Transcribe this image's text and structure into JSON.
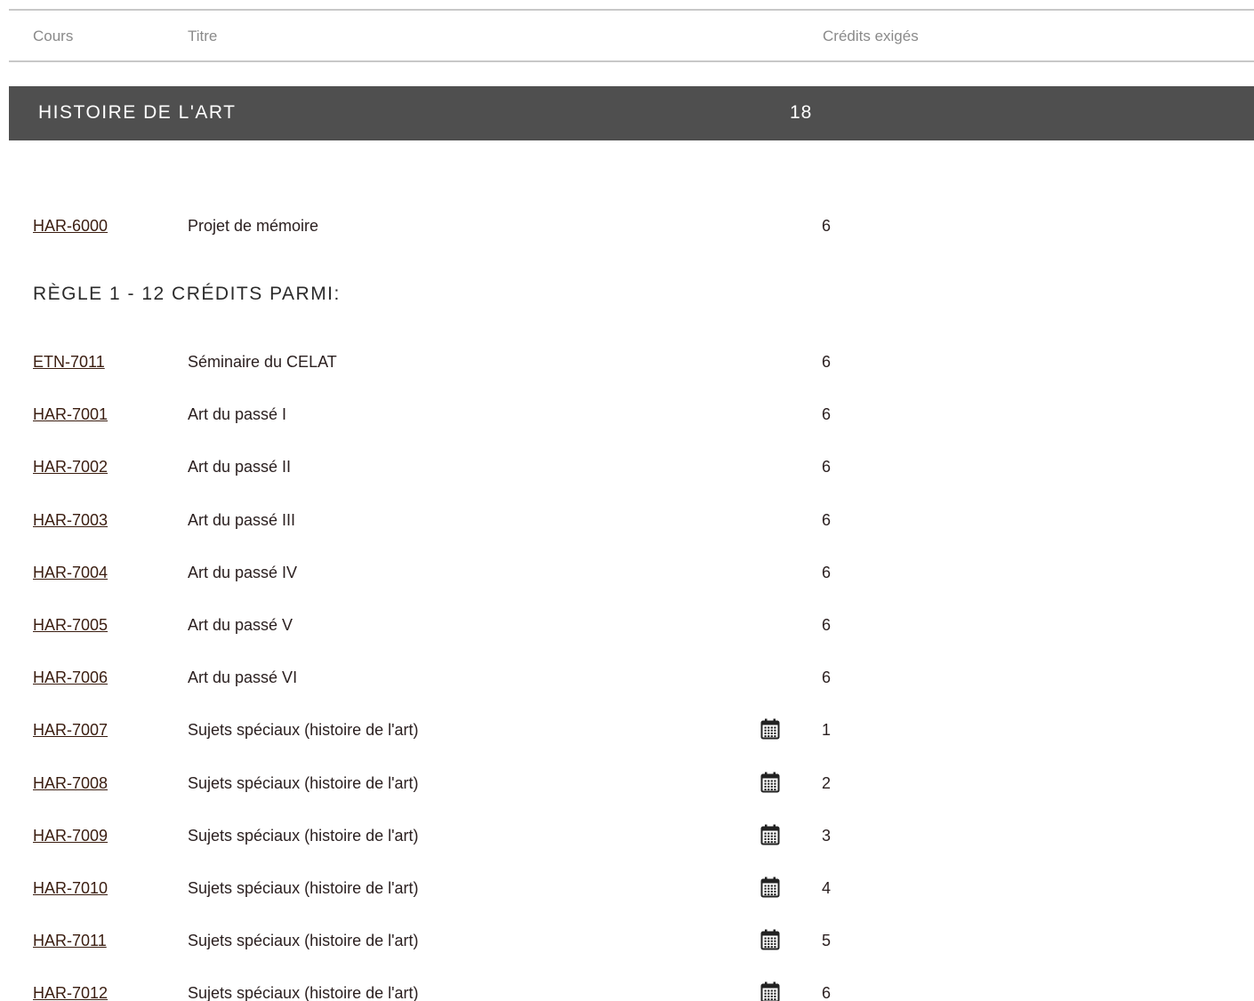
{
  "table_header": {
    "cours": "Cours",
    "titre": "Titre",
    "credits": "Crédits exigés"
  },
  "section": {
    "title": "HISTOIRE DE L'ART",
    "credits": "18"
  },
  "required_course": {
    "code": "HAR-6000",
    "title": "Projet de mémoire",
    "credits": "6"
  },
  "rule1": {
    "title": "RÈGLE 1 - 12 CRÉDITS PARMI:",
    "courses": [
      {
        "code": "ETN-7011",
        "title": "Séminaire du CELAT",
        "credits": "6",
        "calendar_icon": false
      },
      {
        "code": "HAR-7001",
        "title": "Art du passé I",
        "credits": "6",
        "calendar_icon": false
      },
      {
        "code": "HAR-7002",
        "title": "Art du passé II",
        "credits": "6",
        "calendar_icon": false
      },
      {
        "code": "HAR-7003",
        "title": "Art du passé III",
        "credits": "6",
        "calendar_icon": false
      },
      {
        "code": "HAR-7004",
        "title": "Art du passé IV",
        "credits": "6",
        "calendar_icon": false
      },
      {
        "code": "HAR-7005",
        "title": "Art du passé V",
        "credits": "6",
        "calendar_icon": false
      },
      {
        "code": "HAR-7006",
        "title": "Art du passé VI",
        "credits": "6",
        "calendar_icon": false
      },
      {
        "code": "HAR-7007",
        "title": "Sujets spéciaux (histoire de l'art)",
        "credits": "1",
        "calendar_icon": true
      },
      {
        "code": "HAR-7008",
        "title": "Sujets spéciaux (histoire de l'art)",
        "credits": "2",
        "calendar_icon": true
      },
      {
        "code": "HAR-7009",
        "title": "Sujets spéciaux (histoire de l'art)",
        "credits": "3",
        "calendar_icon": true
      },
      {
        "code": "HAR-7010",
        "title": "Sujets spéciaux (histoire de l'art)",
        "credits": "4",
        "calendar_icon": true
      },
      {
        "code": "HAR-7011",
        "title": "Sujets spéciaux (histoire de l'art)",
        "credits": "5",
        "calendar_icon": true
      },
      {
        "code": "HAR-7012",
        "title": "Sujets spéciaux (histoire de l'art)",
        "credits": "6",
        "calendar_icon": true
      }
    ]
  },
  "icons": {
    "schedule": "calendar-icon"
  },
  "colors": {
    "band_background": "#4f4f4f",
    "link": "#3a1d10",
    "header_text": "#8a8a8a"
  }
}
